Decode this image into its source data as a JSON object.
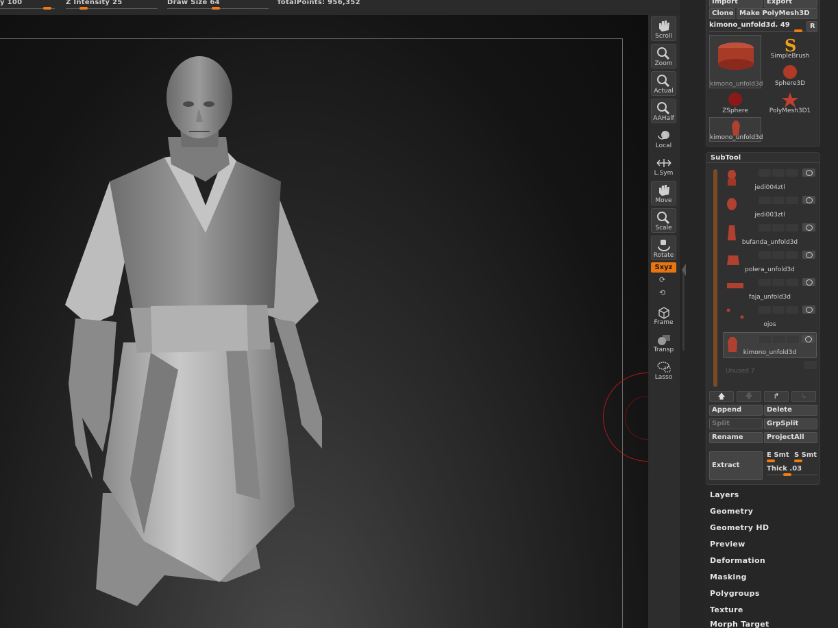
{
  "topbar": {
    "rgb_intensity": "y 100",
    "z_intensity": "Z Intensity 25",
    "draw_size": "Draw Size 64",
    "total_points": "TotalPoints: 956,352",
    "accent": "#f07a14"
  },
  "shelf": {
    "buttons": [
      "Scroll",
      "Zoom",
      "Actual",
      "AAHalf",
      "Local",
      "L.Sym",
      "Move",
      "Scale",
      "Rotate",
      "Frame",
      "Transp",
      "Lasso"
    ],
    "xyz_label": "Sxyz"
  },
  "tool": {
    "import_label": "Import",
    "export_label": "Export",
    "clone_label": "Clone",
    "make_polymesh_label": "Make PolyMesh3D",
    "current_tool": "kimono_unfold3d. 49",
    "r_label": "R",
    "thumbs": [
      "kimono_unfold3d",
      "SimpleBrush",
      "Sphere3D",
      "ZSphere",
      "PolyMesh3D1",
      "kimono_unfold3d"
    ]
  },
  "subtool": {
    "title": "SubTool",
    "items": [
      "jedi004ztl",
      "jedi003ztl",
      "bufanda_unfold3d",
      "polera_unfold3d",
      "faja_unfold3d",
      "ojos",
      "kimono_unfold3d"
    ],
    "unused": "Unused 7",
    "append": "Append",
    "delete": "Delete",
    "split": "Split",
    "grpsplit": "GrpSplit",
    "rename": "Rename",
    "projectall": "ProjectAll",
    "extract": "Extract",
    "e_smt": "E Smt",
    "s_smt": "S Smt",
    "thick": "Thick .03"
  },
  "menus": [
    "Layers",
    "Geometry",
    "Geometry HD",
    "Preview",
    "Deformation",
    "Masking",
    "Polygroups",
    "Texture",
    "Morph Target"
  ]
}
